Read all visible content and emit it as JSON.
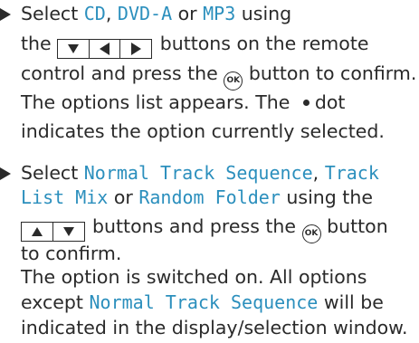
{
  "step1": {
    "line1_pre": "Select ",
    "opt_cd": "CD",
    "sep1": ", ",
    "opt_dvda": "DVD-A",
    "sep2": " or ",
    "opt_mp3": "MP3",
    "line1_post": " using",
    "line2_pre": "the ",
    "line2_post": " buttons on the remote",
    "line3_pre": "control and press the ",
    "line3_post": " button to confirm.",
    "line4": "The options list appears. The ",
    "line4_post": "dot",
    "line5": "indicates the option currently selected."
  },
  "step2": {
    "line1_pre": "Select ",
    "opt_normal": "Normal Track Sequence",
    "line1_post": ", ",
    "opt_track_list_1": "Track",
    "opt_track_list_2": "List Mix",
    "line2_mid": " or ",
    "opt_random": "Random Folder",
    "line2_post": " using the",
    "line3_post": " buttons and press the ",
    "line3_end": " button",
    "line4": "to confirm.",
    "line5": "The option is switched on. All options",
    "line6_pre": "except ",
    "opt_normal_2": "Normal Track Sequence",
    "line6_post": " will be",
    "line7": "indicated in the display/selection window."
  },
  "ok_label": "OK",
  "colors": {
    "highlight": "#2b8fbd",
    "text": "#2a2a2a"
  },
  "icons": [
    "down-arrow-key-icon",
    "left-arrow-key-icon",
    "right-arrow-key-icon",
    "up-arrow-key-icon",
    "ok-button-icon",
    "selection-dot-icon"
  ]
}
